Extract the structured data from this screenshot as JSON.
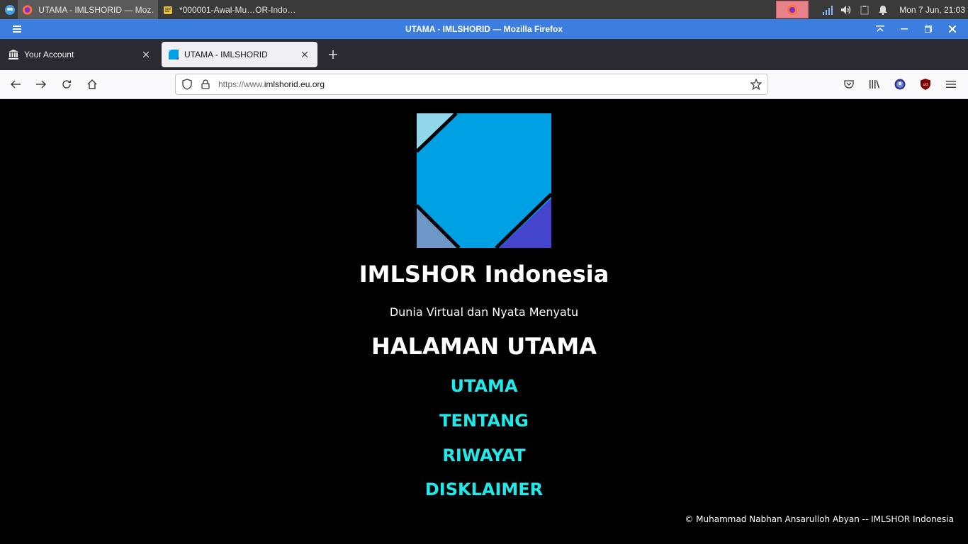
{
  "taskbar": {
    "items": [
      {
        "label": "UTAMA - IMLSHORID — Moz…",
        "active": true
      },
      {
        "label": "*000001-Awal-Mu…OR-Indo…",
        "active": false
      }
    ],
    "clock": "Mon  7 Jun, 21:03"
  },
  "window": {
    "title": "UTAMA - IMLSHORID — Mozilla Firefox"
  },
  "tabs": [
    {
      "label": "Your Account"
    },
    {
      "label": "UTAMA - IMLSHORID"
    }
  ],
  "urlbar": {
    "protocol": "https://www.",
    "domain": "imlshorid.eu.org"
  },
  "page": {
    "site_title": "IMLSHOR Indonesia",
    "tagline": "Dunia Virtual dan Nyata Menyatu",
    "heading": "HALAMAN UTAMA",
    "links": [
      {
        "label": "UTAMA"
      },
      {
        "label": "TENTANG"
      },
      {
        "label": "RIWAYAT"
      },
      {
        "label": "DISKLAIMER"
      }
    ],
    "footer": "© Muhammad Nabhan Ansarulloh Abyan -- IMLSHOR Indonesia"
  },
  "colors": {
    "link": "#1fe9ea",
    "logo_main": "#00a0e4",
    "logo_top_left": "#92d6ea",
    "logo_bottom_left": "#6e96c6",
    "logo_bottom_right": "#4444cc",
    "titlebar": "#3c7ee0"
  }
}
